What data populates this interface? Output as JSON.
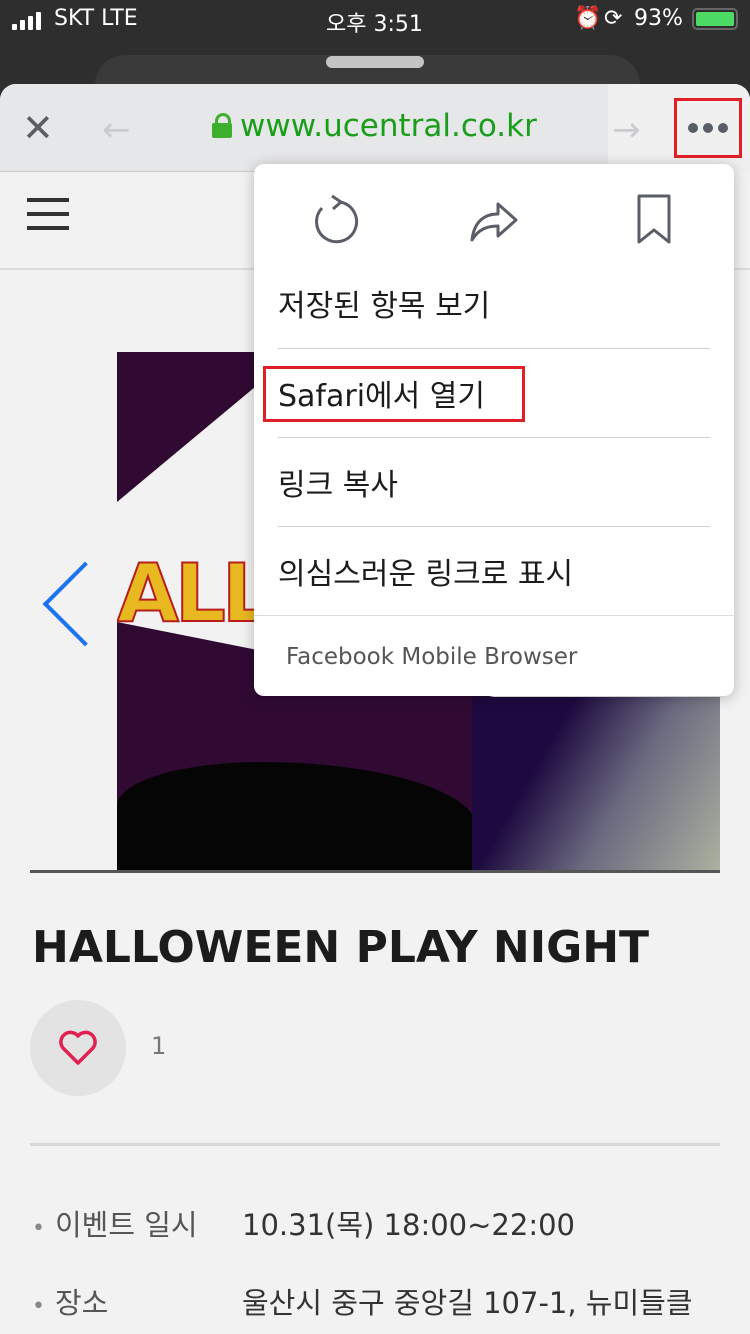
{
  "status_bar": {
    "carrier": "SKT LTE",
    "time": "오후 3:51",
    "battery": "93%",
    "battery_level": 0.93
  },
  "browser": {
    "url": "www.ucentral.co.kr",
    "close_icon": "close-icon",
    "back_icon": "arrow-left-icon",
    "forward_icon": "arrow-right-icon",
    "more_icon": "more-dots-icon"
  },
  "menu": {
    "icons": [
      "reload-icon",
      "share-icon",
      "bookmark-icon"
    ],
    "items": [
      {
        "label": "저장된 항목 보기"
      },
      {
        "label": "Safari에서 열기"
      },
      {
        "label": "링크 복사"
      },
      {
        "label": "의심스러운 링크로 표시"
      }
    ],
    "footer": "Facebook Mobile Browser"
  },
  "page": {
    "banner_text": "ALLOW",
    "title": "HALLOWEEN PLAY NIGHT",
    "likes": "1",
    "info": [
      {
        "label": "이벤트 일시",
        "value": "10.31(목) 18:00~22:00"
      },
      {
        "label": "장소",
        "value": "울산시 중구 중앙길 107-1, 뉴미들클"
      }
    ]
  },
  "colors": {
    "url_green": "#1a9e1a",
    "highlight_red": "#e41e26",
    "accent_blue": "#1a73f0",
    "heart": "#e0204f"
  }
}
